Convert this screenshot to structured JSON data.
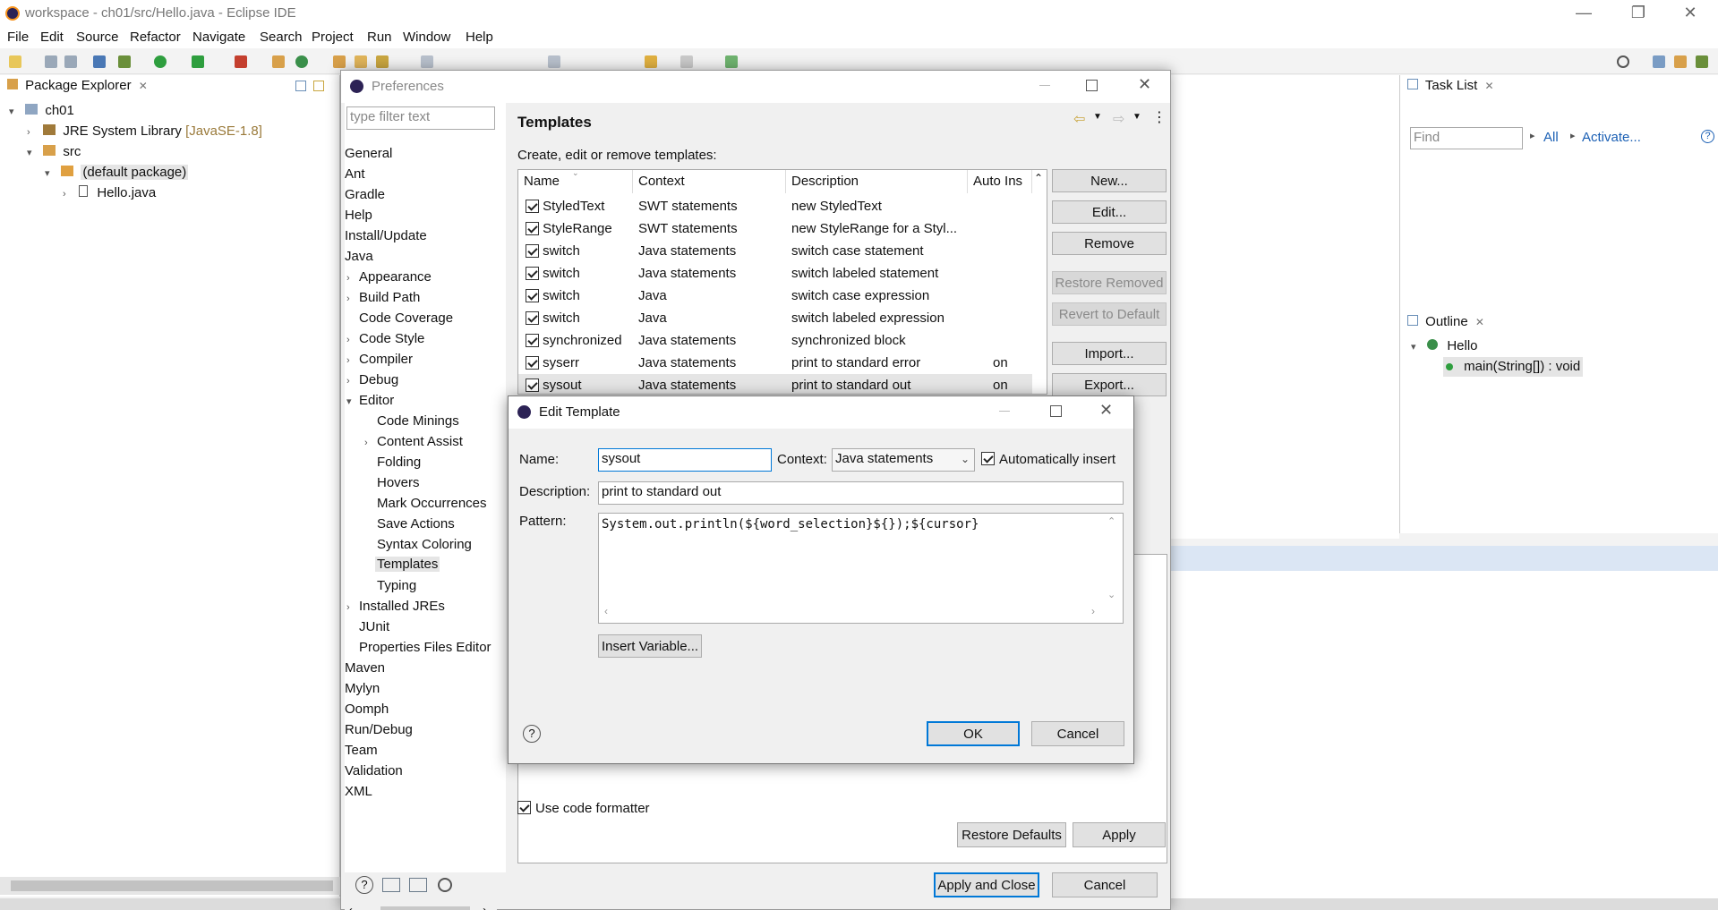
{
  "window": {
    "title": "workspace - ch01/src/Hello.java - Eclipse IDE",
    "min": "—",
    "restore": "❐",
    "close": "✕"
  },
  "menu": [
    "File",
    "Edit",
    "Source",
    "Refactor",
    "Navigate",
    "Search",
    "Project",
    "Run",
    "Window",
    "Help"
  ],
  "package_explorer": {
    "tab": "Package Explorer",
    "tree": [
      {
        "label": "ch01",
        "twisty": "▾"
      },
      {
        "label": "JRE System Library",
        "suffix": "[JavaSE-1.8]",
        "twisty": "›"
      },
      {
        "label": "src",
        "twisty": "▾"
      },
      {
        "label": "(default package)",
        "twisty": "▾"
      },
      {
        "label": "Hello.java",
        "twisty": "›"
      }
    ]
  },
  "task_list": {
    "tab": "Task List",
    "find_placeholder": "Find",
    "all": "All",
    "activate": "Activate..."
  },
  "outline": {
    "tab": "Outline",
    "class_name": "Hello",
    "method": "main(String[]) : void"
  },
  "preferences": {
    "title": "Preferences",
    "filter_placeholder": "type filter text",
    "page_title": "Templates",
    "description": "Create, edit or remove templates:",
    "tree": {
      "general": "General",
      "ant": "Ant",
      "gradle": "Gradle",
      "help": "Help",
      "install": "Install/Update",
      "java": "Java",
      "appearance": "Appearance",
      "build_path": "Build Path",
      "code_coverage": "Code Coverage",
      "code_style": "Code Style",
      "compiler": "Compiler",
      "debug": "Debug",
      "editor": "Editor",
      "code_minings": "Code Minings",
      "content_assist": "Content Assist",
      "folding": "Folding",
      "hovers": "Hovers",
      "mark_occurrences": "Mark Occurrences",
      "save_actions": "Save Actions",
      "syntax_coloring": "Syntax Coloring",
      "templates": "Templates",
      "typing": "Typing",
      "installed_jres": "Installed JREs",
      "junit": "JUnit",
      "properties_editor": "Properties Files Editor",
      "maven": "Maven",
      "mylyn": "Mylyn",
      "oomph": "Oomph",
      "run_debug": "Run/Debug",
      "team": "Team",
      "validation": "Validation",
      "xml": "XML"
    },
    "columns": [
      "Name",
      "Context",
      "Description",
      "Auto Ins"
    ],
    "rows": [
      {
        "name": "StyledText",
        "context": "SWT statements",
        "description": "new StyledText",
        "auto": ""
      },
      {
        "name": "StyleRange",
        "context": "SWT statements",
        "description": "new StyleRange for a Styl...",
        "auto": ""
      },
      {
        "name": "switch",
        "context": "Java statements",
        "description": "switch case statement",
        "auto": ""
      },
      {
        "name": "switch",
        "context": "Java statements",
        "description": "switch labeled statement",
        "auto": ""
      },
      {
        "name": "switch",
        "context": "Java",
        "description": "switch case expression",
        "auto": ""
      },
      {
        "name": "switch",
        "context": "Java",
        "description": "switch labeled expression",
        "auto": ""
      },
      {
        "name": "synchronized",
        "context": "Java statements",
        "description": "synchronized block",
        "auto": ""
      },
      {
        "name": "syserr",
        "context": "Java statements",
        "description": "print to standard error",
        "auto": "on"
      },
      {
        "name": "sysout",
        "context": "Java statements",
        "description": "print to standard out",
        "auto": "on"
      }
    ],
    "buttons": {
      "new": "New...",
      "edit": "Edit...",
      "remove": "Remove",
      "restore_removed": "Restore Removed",
      "revert_default": "Revert to Default",
      "import": "Import...",
      "export": "Export..."
    },
    "use_formatter": "Use code formatter",
    "restore_defaults": "Restore Defaults",
    "apply": "Apply",
    "apply_close": "Apply and Close",
    "cancel": "Cancel"
  },
  "edit_template": {
    "title": "Edit Template",
    "name_label": "Name:",
    "name_value": "sysout",
    "context_label": "Context:",
    "context_value": "Java statements",
    "auto_insert": "Automatically insert",
    "description_label": "Description:",
    "description_value": "print to standard out",
    "pattern_label": "Pattern:",
    "pattern_value": "System.out.println(${word_selection}${});${cursor}",
    "insert_variable": "Insert Variable...",
    "ok": "OK",
    "cancel": "Cancel",
    "help": "?"
  },
  "colors": {
    "accent": "#0078d7",
    "selection": "#e5e5e5",
    "link": "#1a5fb4"
  }
}
